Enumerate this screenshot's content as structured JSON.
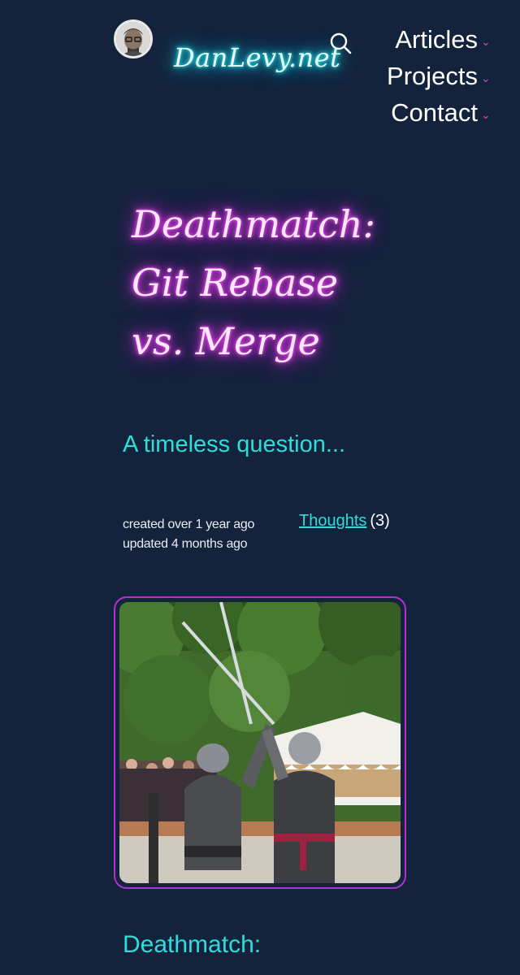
{
  "header": {
    "site_title": "DanLevy.net",
    "nav": [
      {
        "label": "Articles"
      },
      {
        "label": "Projects"
      },
      {
        "label": "Contact"
      }
    ],
    "icons": {
      "search": "search-icon",
      "caret": "chevron-down-icon",
      "avatar": "avatar"
    }
  },
  "post": {
    "title_lines": [
      "Deathmatch:",
      "Git Rebase",
      "vs. Merge"
    ],
    "subtitle": "A timeless question...",
    "created": "created over 1 year ago",
    "updated": "updated 4 months ago",
    "category": "Thoughts",
    "category_count": "(3)",
    "section_heading": "Deathmatch:"
  },
  "colors": {
    "background": "#14233c",
    "cyan_accent": "#2fdcdc",
    "magenta_accent": "#e040c0",
    "image_border": "#b230d0"
  }
}
